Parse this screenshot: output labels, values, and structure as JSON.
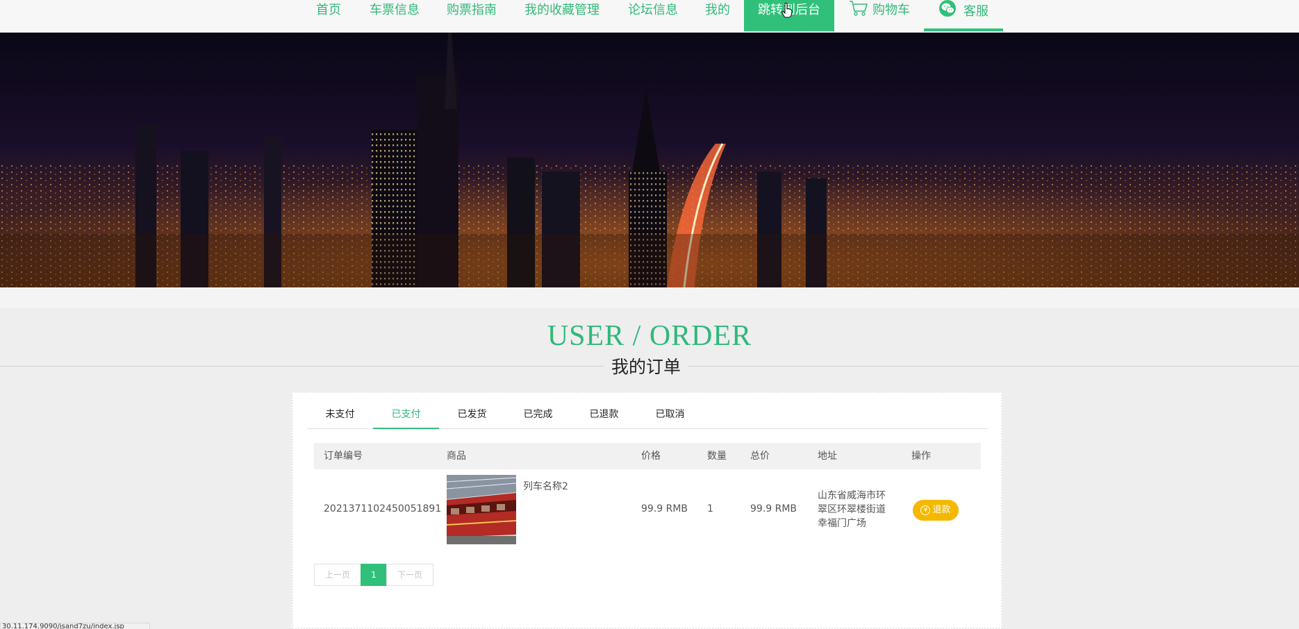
{
  "nav": {
    "items": [
      "首页",
      "车票信息",
      "购票指南",
      "我的收藏管理",
      "论坛信息",
      "我的"
    ],
    "backend_label": "跳转到后台",
    "cart_label": "购物车",
    "service_label": "客服"
  },
  "colors": {
    "accent": "#30c07a",
    "refund": "#f5b800"
  },
  "heading": {
    "en": "USER / ORDER",
    "cn": "我的订单"
  },
  "tabs": [
    "未支付",
    "已支付",
    "已发货",
    "已完成",
    "已退款",
    "已取消"
  ],
  "active_tab": "已支付",
  "table": {
    "headers": [
      "订单编号",
      "商品",
      "价格",
      "数量",
      "总价",
      "地址",
      "操作"
    ],
    "rows": [
      {
        "order_no": "2021371102450051891",
        "product": "列车名称2",
        "price": "99.9 RMB",
        "quantity": "1",
        "total": "99.9 RMB",
        "address": [
          "山东省威海市环",
          "翠区环翠楼街道",
          "幸福门广场"
        ],
        "action": "退款"
      }
    ]
  },
  "pager": {
    "prev": "上一页",
    "current": "1",
    "next": "下一页"
  },
  "status_bar": "30.11.174.9090/jsand7zu/index.jsp"
}
